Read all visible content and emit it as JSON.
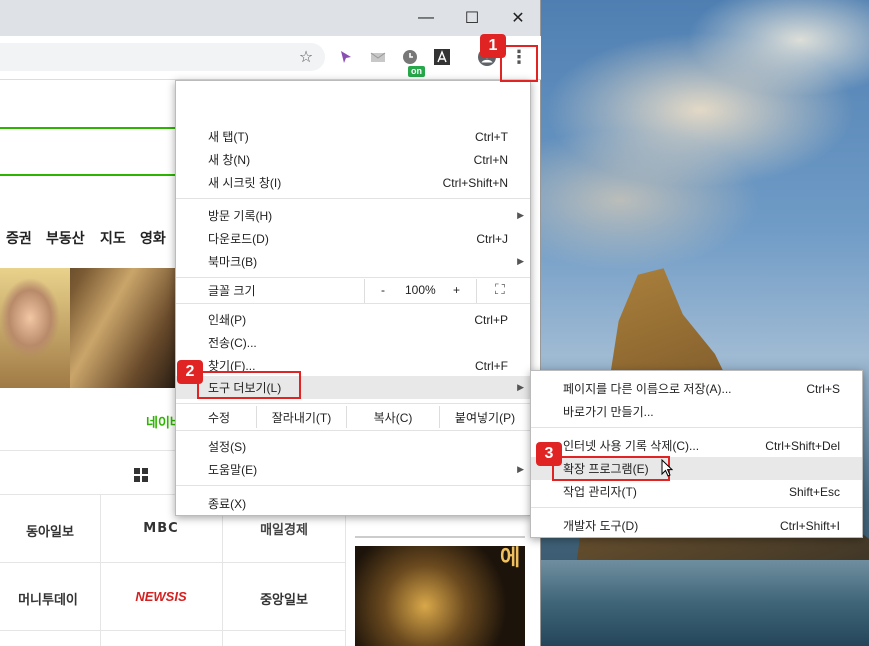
{
  "window": {
    "minimize_glyph": "—",
    "maximize_glyph": "☐",
    "close_glyph": "✕"
  },
  "toolbar": {
    "star_icon": "☆",
    "on_badge": "on",
    "menu_icon": "⋮"
  },
  "page": {
    "nav_items": [
      "증권",
      "부동산",
      "지도",
      "영화"
    ],
    "naver_link": "네이버",
    "press": [
      "동아일보",
      "MBC",
      "매일경제",
      "머니투데이",
      "NEWSIS",
      "중앙일보"
    ],
    "ad_text": "에"
  },
  "menu": {
    "new_tab": {
      "label": "새 탭(T)",
      "shortcut": "Ctrl+T"
    },
    "new_window": {
      "label": "새 창(N)",
      "shortcut": "Ctrl+N"
    },
    "incognito": {
      "label": "새 시크릿 창(I)",
      "shortcut": "Ctrl+Shift+N"
    },
    "history": {
      "label": "방문 기록(H)"
    },
    "downloads": {
      "label": "다운로드(D)",
      "shortcut": "Ctrl+J"
    },
    "bookmarks": {
      "label": "북마크(B)"
    },
    "zoom": {
      "label": "글꼴 크기",
      "minus": "-",
      "value": "100%",
      "plus": "+",
      "fullscreen": "⛶"
    },
    "print": {
      "label": "인쇄(P)",
      "shortcut": "Ctrl+P"
    },
    "cast": {
      "label": "전송(C)..."
    },
    "find": {
      "label": "찾기(F)...",
      "shortcut": "Ctrl+F"
    },
    "more_tools": {
      "label": "도구 더보기(L)"
    },
    "edit": {
      "label": "수정",
      "cut": "잘라내기(T)",
      "copy": "복사(C)",
      "paste": "붙여넣기(P)"
    },
    "settings": {
      "label": "설정(S)"
    },
    "help": {
      "label": "도움말(E)"
    },
    "exit": {
      "label": "종료(X)"
    }
  },
  "submenu": {
    "save_page": {
      "label": "페이지를 다른 이름으로 저장(A)...",
      "shortcut": "Ctrl+S"
    },
    "shortcut": {
      "label": "바로가기 만들기..."
    },
    "clear_data": {
      "label": "인터넷 사용 기록 삭제(C)...",
      "shortcut": "Ctrl+Shift+Del"
    },
    "extensions": {
      "label": "확장 프로그램(E)"
    },
    "task_manager": {
      "label": "작업 관리자(T)",
      "shortcut": "Shift+Esc"
    },
    "dev_tools": {
      "label": "개발자 도구(D)",
      "shortcut": "Ctrl+Shift+I"
    }
  },
  "steps": [
    "1",
    "2",
    "3"
  ],
  "colors": {
    "accent_red": "#e02424",
    "naver_green": "#2db400"
  }
}
